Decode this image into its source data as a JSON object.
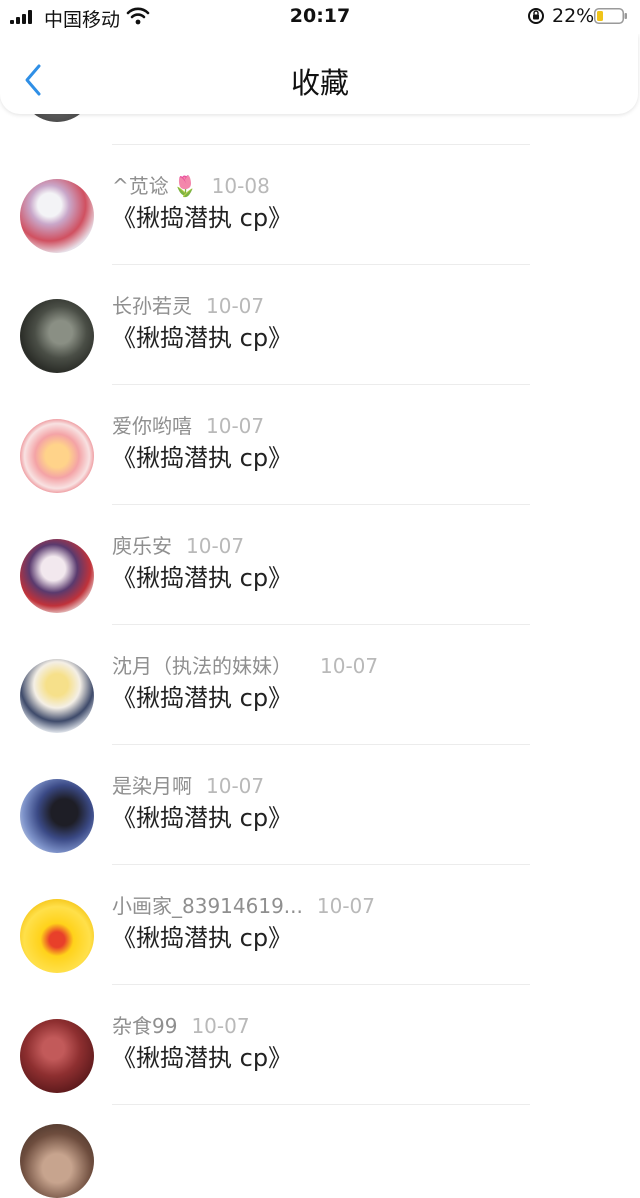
{
  "status_bar": {
    "carrier": "中国移动",
    "time": "20:17",
    "battery": "22%"
  },
  "header": {
    "title": "收藏"
  },
  "items": [
    {
      "user": "^苋谂",
      "emoji": "🌷",
      "date": "10-08",
      "title": "《揪捣潜执 cp》"
    },
    {
      "user": "长孙若灵",
      "date": "10-07",
      "title": "《揪捣潜执 cp》"
    },
    {
      "user": "爱你哟嘻",
      "date": "10-07",
      "title": "《揪捣潜执 cp》"
    },
    {
      "user": "庾乐安",
      "date": "10-07",
      "title": "《揪捣潜执 cp》"
    },
    {
      "user": "沈月（执法的妹妹）",
      "date": "10-07",
      "title": "《揪捣潜执 cp》"
    },
    {
      "user": "是染月啊",
      "date": "10-07",
      "title": "《揪捣潜执 cp》"
    },
    {
      "user": "小画家_83914619...",
      "date": "10-07",
      "title": "《揪捣潜执 cp》"
    },
    {
      "user": "杂食99",
      "date": "10-07",
      "title": "《揪捣潜执 cp》"
    }
  ]
}
